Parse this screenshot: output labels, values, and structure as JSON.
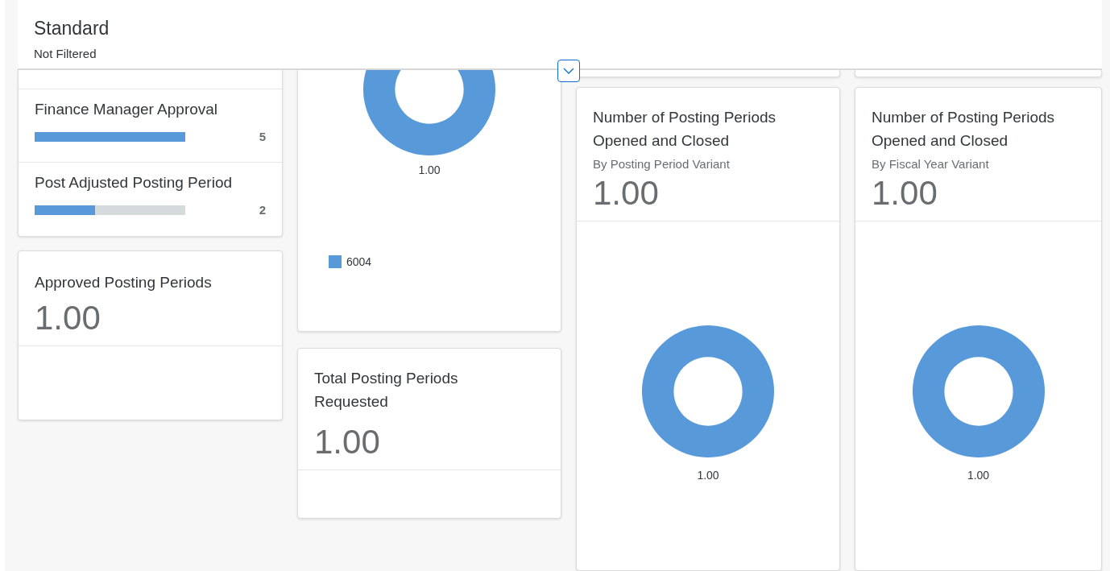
{
  "header": {
    "title": "Standard",
    "subtitle": "Not Filtered"
  },
  "progress_card": {
    "rows": [
      {
        "label": "Finance Manager Approval",
        "level": 1.0,
        "value": "5"
      },
      {
        "label": "Post Adjusted Posting Period",
        "level": 0.4,
        "value": "2"
      }
    ]
  },
  "approved_card": {
    "title": "Approved Posting Periods",
    "value": "1.00"
  },
  "donut_card": {
    "value_label": "1.00",
    "legend": [
      {
        "label": "6004",
        "color": "#5899da"
      }
    ]
  },
  "requested_card": {
    "title_lines": [
      "Total Posting Periods",
      "Requested"
    ],
    "value": "1.00"
  },
  "variant_cards": [
    {
      "title_lines": [
        "Number of Posting Periods",
        "Opened and Closed"
      ],
      "subtitle": "By Posting Period Variant",
      "value": "1.00",
      "donut_label": "1.00"
    },
    {
      "title_lines": [
        "Number of Posting Periods",
        "Opened and Closed"
      ],
      "subtitle": "By Fiscal Year Variant",
      "value": "1.00",
      "donut_label": "1.00"
    }
  ]
}
